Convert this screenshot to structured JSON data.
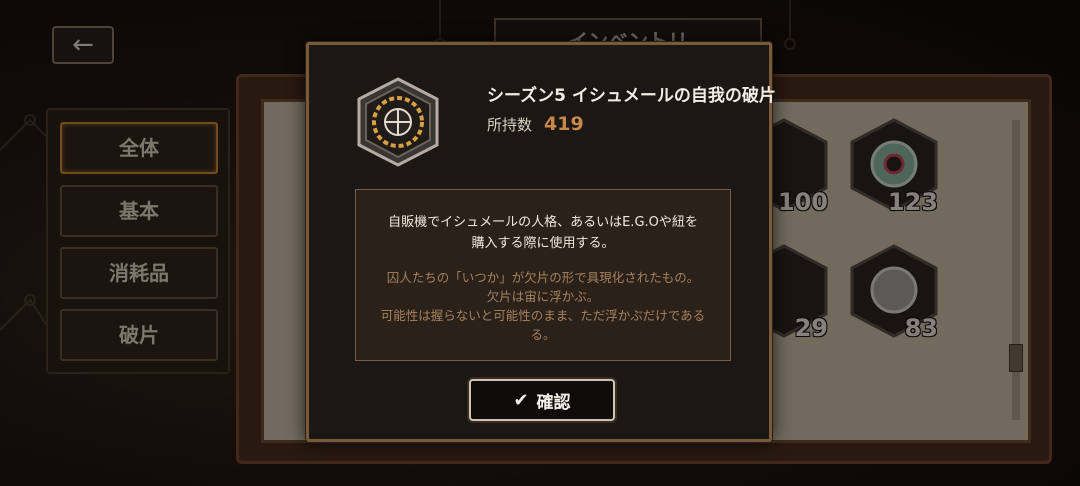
{
  "header": {
    "back_icon": "arrow-left-icon",
    "tab_title": "インベントリ"
  },
  "sidebar": {
    "items": [
      {
        "label": "全体",
        "active": true
      },
      {
        "label": "基本",
        "active": false
      },
      {
        "label": "消耗品",
        "active": false
      },
      {
        "label": "破片",
        "active": false
      }
    ]
  },
  "inventory": {
    "visible_counts": [
      "100",
      "123",
      "29",
      "83"
    ]
  },
  "modal": {
    "item_name": "シーズン5 イシュメールの自我の破片",
    "owned_label": "所持数",
    "owned_value": "419",
    "description": [
      "自販機でイシュメールの人格、あるいはE.G.Oや紐を",
      "購入する際に使用する。"
    ],
    "flavor": [
      "囚人たちの「いつか」が欠片の形で具現化されたもの。",
      "欠片は宙に浮かぶ。",
      "可能性は握らないと可能性のまま、ただ浮かぶだけである",
      "る。"
    ],
    "confirm_label": "確認",
    "confirm_icon": "checkmark-icon"
  },
  "colors": {
    "accent": "#c8884a",
    "active_border": "#d08a3a",
    "modal_border": "#7a5838"
  }
}
